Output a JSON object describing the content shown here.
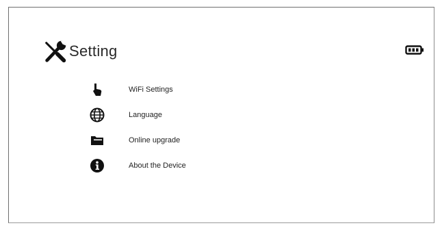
{
  "screen": {
    "title": "Setting",
    "icon": "wrench-screwdriver-icon",
    "status_icon": "battery-icon"
  },
  "menu": {
    "items": [
      {
        "label": "WiFi Settings",
        "icon": "hand-pointer-icon"
      },
      {
        "label": "Language",
        "icon": "globe-icon"
      },
      {
        "label": "Online upgrade",
        "icon": "folder-icon"
      },
      {
        "label": "About the Device",
        "icon": "info-icon"
      }
    ]
  },
  "colors": {
    "icon": "#111111",
    "text": "#1f1f1f",
    "border": "#6e6e6e"
  }
}
